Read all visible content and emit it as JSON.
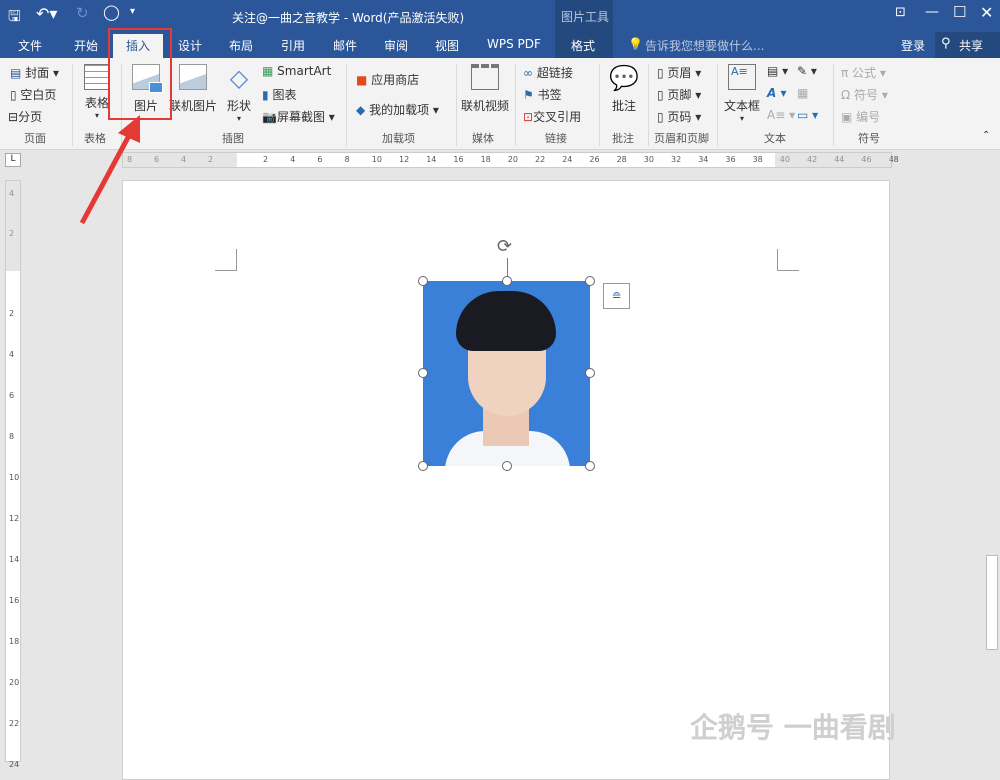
{
  "titlebar": {
    "title": "关注@一曲之音教学 - Word(产品激活失败)",
    "context_tool": "图片工具"
  },
  "tabs": [
    {
      "label": "文件"
    },
    {
      "label": "开始"
    },
    {
      "label": "插入",
      "active": true
    },
    {
      "label": "设计"
    },
    {
      "label": "布局"
    },
    {
      "label": "引用"
    },
    {
      "label": "邮件"
    },
    {
      "label": "审阅"
    },
    {
      "label": "视图"
    },
    {
      "label": "WPS PDF"
    },
    {
      "label": "格式"
    }
  ],
  "tell_me": "告诉我您想要做什么...",
  "login": "登录",
  "share": "共享",
  "ribbon": {
    "pages": {
      "items": [
        "封面",
        "空白页",
        "分页"
      ],
      "group": "页面"
    },
    "table": {
      "label": "表格",
      "group": "表格"
    },
    "illus": {
      "picture": "图片",
      "online_picture": "联机图片",
      "shapes": "形状",
      "smartart": "SmartArt",
      "chart": "图表",
      "screenshot": "屏幕截图",
      "group": "插图"
    },
    "addins": {
      "store": "应用商店",
      "my_addins": "我的加载项",
      "group": "加载项"
    },
    "media": {
      "online_video": "联机视频",
      "group": "媒体"
    },
    "links": {
      "hyperlink": "超链接",
      "bookmark": "书签",
      "cross_ref": "交叉引用",
      "group": "链接"
    },
    "comments": {
      "comment": "批注",
      "group": "批注"
    },
    "hf": {
      "header": "页眉",
      "footer": "页脚",
      "page_number": "页码",
      "group": "页眉和页脚"
    },
    "text": {
      "textbox": "文本框",
      "group": "文本"
    },
    "symbols": {
      "equation": "公式",
      "symbol": "符号",
      "number": "编号",
      "group": "符号"
    }
  },
  "hruler": [
    "8",
    "6",
    "4",
    "2",
    "2",
    "4",
    "6",
    "8",
    "10",
    "12",
    "14",
    "16",
    "18",
    "20",
    "22",
    "24",
    "26",
    "28",
    "30",
    "32",
    "34",
    "36",
    "38",
    "40",
    "42",
    "44",
    "46",
    "48"
  ],
  "vruler": [
    "4",
    "2",
    "2",
    "4",
    "6",
    "8",
    "10",
    "12",
    "14",
    "16",
    "18",
    "20",
    "22",
    "24"
  ],
  "watermark": "企鹅号 一曲看剧",
  "colors": {
    "brand": "#2b579a",
    "highlight": "#e53935",
    "photo_bg": "#3a7fd8"
  }
}
